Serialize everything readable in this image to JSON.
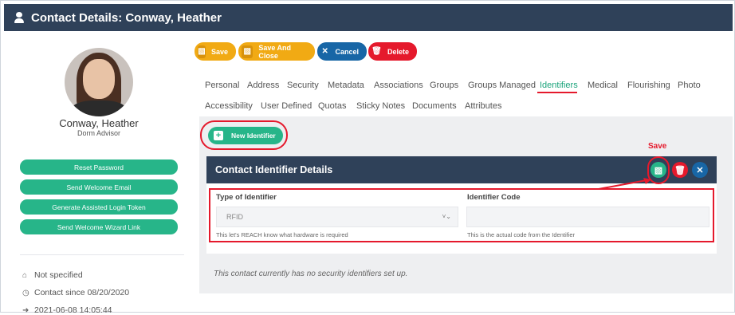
{
  "window": {
    "title": "Contact Details: Conway, Heather"
  },
  "profile": {
    "name": "Conway, Heather",
    "role": "Dorm Advisor",
    "actions": [
      "Reset Password",
      "Send Welcome Email",
      "Generate Assisted Login Token",
      "Send Welcome Wizard Link"
    ],
    "meta": [
      {
        "icon": "home-icon",
        "text": "Not specified"
      },
      {
        "icon": "clock-icon",
        "text": "Contact since 08/20/2020"
      },
      {
        "icon": "sign-in-icon",
        "text": "2021-06-08 14:05:44"
      }
    ]
  },
  "toolbar": {
    "save": "Save",
    "save_close": "Save And Close",
    "cancel": "Cancel",
    "delete": "Delete"
  },
  "tabs": {
    "row1": [
      "Personal",
      "Address",
      "Security",
      "Metadata",
      "Associations",
      "Groups",
      "Groups Managed",
      "Identifiers",
      "Medical",
      "Flourishing",
      "Photo"
    ],
    "row2": [
      "Accessibility",
      "User Defined",
      "Quotas",
      "Sticky Notes",
      "Documents",
      "Attributes"
    ],
    "active": "Identifiers"
  },
  "identifiers": {
    "new_button": "New Identifier",
    "annotation_save": "Save",
    "card_title": "Contact Identifier Details",
    "type_label": "Type of Identifier",
    "type_value": "RFID",
    "type_help": "This let's REACH know what hardware is required",
    "code_label": "Identifier Code",
    "code_value": "",
    "code_help": "This is the actual code from the Identifier",
    "empty_message": "This contact currently has no security identifiers set up."
  },
  "colors": {
    "navy": "#2f4159",
    "green": "#27b589",
    "yellow": "#f1aa14",
    "blue": "#1866a6",
    "red": "#e5192c"
  }
}
